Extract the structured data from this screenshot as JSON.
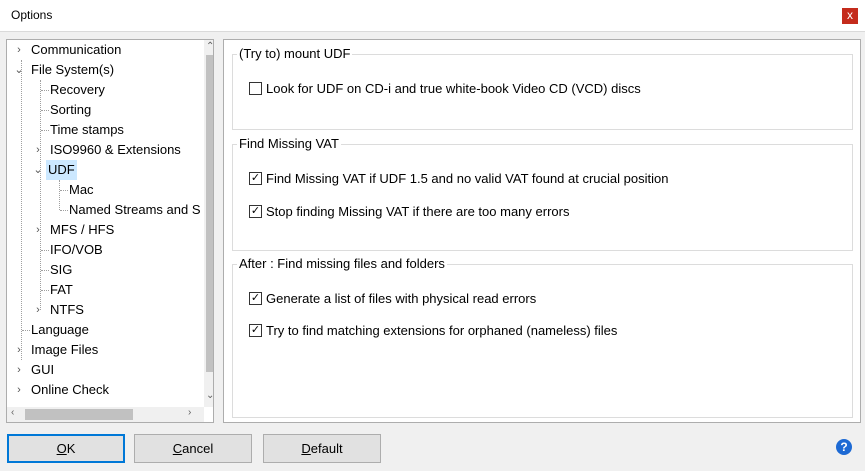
{
  "window": {
    "title": "Options",
    "close_label": "x"
  },
  "tree": {
    "items": [
      {
        "label": "Communication"
      },
      {
        "label": "File System(s)"
      },
      {
        "label": "Recovery"
      },
      {
        "label": "Sorting"
      },
      {
        "label": "Time stamps"
      },
      {
        "label": "ISO9960 & Extensions"
      },
      {
        "label": "UDF"
      },
      {
        "label": "Mac"
      },
      {
        "label": "Named Streams and S"
      },
      {
        "label": "MFS / HFS"
      },
      {
        "label": "IFO/VOB"
      },
      {
        "label": "SIG"
      },
      {
        "label": "FAT"
      },
      {
        "label": "NTFS"
      },
      {
        "label": "Language"
      },
      {
        "label": "Image Files"
      },
      {
        "label": "GUI"
      },
      {
        "label": "Online Check"
      }
    ],
    "selected": "UDF"
  },
  "groups": {
    "mount_udf": {
      "title": "(Try to) mount UDF",
      "options": [
        {
          "label": "Look for UDF on CD-i and true white-book Video CD (VCD) discs",
          "checked": false
        }
      ]
    },
    "find_vat": {
      "title": "Find Missing VAT",
      "options": [
        {
          "label": "Find Missing VAT if UDF 1.5 and no valid VAT found at crucial position",
          "checked": true
        },
        {
          "label": "Stop finding Missing VAT if there are too many errors",
          "checked": true
        }
      ]
    },
    "after": {
      "title": "After : Find missing files and folders",
      "options": [
        {
          "label": "Generate a list of files with physical read errors",
          "checked": true
        },
        {
          "label": "Try to find matching extensions for orphaned (nameless) files",
          "checked": true
        }
      ]
    }
  },
  "buttons": {
    "ok": {
      "mnemonic": "O",
      "rest": "K"
    },
    "cancel": {
      "mnemonic": "C",
      "rest": "ancel"
    },
    "default": {
      "mnemonic": "D",
      "rest": "efault"
    }
  },
  "help_label": "?",
  "icons": {
    "collapsed": "chevron-right-icon",
    "expanded": "chevron-down-icon"
  }
}
